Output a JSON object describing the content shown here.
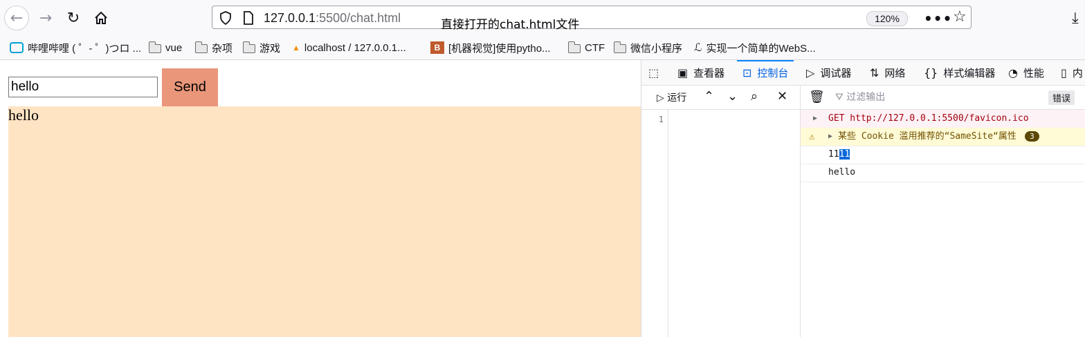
{
  "browser": {
    "url_host": "127.0.0.1",
    "url_path": ":5500/chat.html",
    "zoom": "120%",
    "caption": "直接打开的chat.html文件"
  },
  "bookmarks": [
    {
      "label": "哔哩哔哩 ( ゜- ゜)つロ ...",
      "icon": "bilibili-icon"
    },
    {
      "label": "vue",
      "icon": "folder-icon"
    },
    {
      "label": "杂项",
      "icon": "folder-icon"
    },
    {
      "label": "游戏",
      "icon": "folder-icon"
    },
    {
      "label": "localhost / 127.0.0.1...",
      "icon": "phpmyadmin-icon"
    },
    {
      "label": "[机器视觉]使用pytho...",
      "icon": "site-icon"
    },
    {
      "label": "CTF",
      "icon": "folder-icon"
    },
    {
      "label": "微信小程序",
      "icon": "folder-icon"
    },
    {
      "label": "实现一个简单的WebS...",
      "icon": "site-icon"
    }
  ],
  "page": {
    "input_value": "hello",
    "send_label": "Send",
    "chat_text": "hello"
  },
  "devtools": {
    "tabs": [
      "查看器",
      "控制台",
      "调试器",
      "网络",
      "样式编辑器",
      "性能",
      "内"
    ],
    "run_label": "运行",
    "line_number": "1",
    "filter_placeholder": "过滤输出",
    "error_filter": "错误",
    "messages": {
      "error": "GET http://127.0.0.1:5500/favicon.ico",
      "warning": "某些 Cookie 滥用推荐的“SameSite“属性",
      "warning_count": "3",
      "log1_a": "11",
      "log1_b": "11",
      "log2": "hello"
    }
  },
  "colors": {
    "send_button": "#e9967a",
    "chat_area": "#ffe4c4",
    "active_tab": "#0060df"
  }
}
